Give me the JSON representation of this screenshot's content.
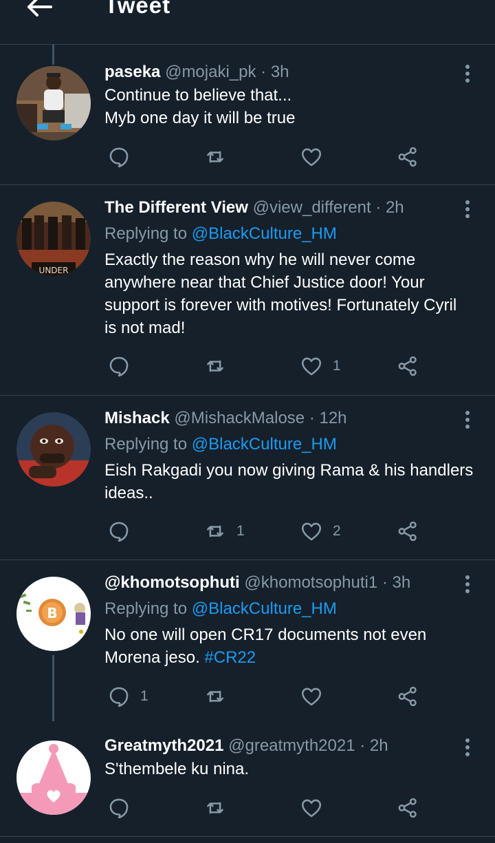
{
  "header": {
    "title": "Tweet",
    "back_icon": "arrow-left-icon"
  },
  "colors": {
    "background": "#15202b",
    "accent": "#1d9bf0",
    "muted": "#8899a6",
    "divider": "#38444d"
  },
  "tweets": [
    {
      "name": "paseka",
      "handle": "@mojaki_pk",
      "time": "· 3h",
      "replying_prefix": "",
      "replying_to": "",
      "text_lines": [
        "Continue to believe that...",
        "Myb one day it will be true"
      ],
      "hashtag": "",
      "counts": {
        "reply": "",
        "retweet": "",
        "like": ""
      }
    },
    {
      "name": "The Different View",
      "handle": "@view_different",
      "time": "· 2h",
      "replying_prefix": "Replying to",
      "replying_to": "@BlackCulture_HM",
      "text_lines": [
        "Exactly the reason why he will never come",
        "anywhere near that Chief Justice door! Your",
        "support is forever with motives! Fortunately Cyril",
        "is not mad!"
      ],
      "hashtag": "",
      "counts": {
        "reply": "",
        "retweet": "",
        "like": "1"
      }
    },
    {
      "name": "Mishack",
      "handle": "@MishackMalose",
      "time": "· 12h",
      "replying_prefix": "Replying to",
      "replying_to": "@BlackCulture_HM",
      "text_lines": [
        "Eish Rakgadi you now giving Rama & his handlers",
        "ideas.."
      ],
      "hashtag": "",
      "counts": {
        "reply": "",
        "retweet": "1",
        "like": "2"
      }
    },
    {
      "name": "@khomotsophuti",
      "handle": "@khomotsophuti1",
      "time": "· 3h",
      "replying_prefix": "Replying to",
      "replying_to": "@BlackCulture_HM",
      "text_lines": [
        "No one will open CR17 documents not even",
        "Morena jeso. "
      ],
      "hashtag": "#CR22",
      "counts": {
        "reply": "1",
        "retweet": "",
        "like": ""
      }
    },
    {
      "name": "Greatmyth2021",
      "handle": "@greatmyth2021",
      "time": "· 2h",
      "replying_prefix": "",
      "replying_to": "",
      "text_lines": [
        "S'thembele ku nina."
      ],
      "hashtag": "",
      "counts": {
        "reply": "",
        "retweet": "",
        "like": ""
      }
    }
  ],
  "icons": {
    "reply": "reply-bubble-icon",
    "retweet": "retweet-icon",
    "like": "heart-icon",
    "share": "share-icon",
    "more": "more-vertical-icon"
  }
}
